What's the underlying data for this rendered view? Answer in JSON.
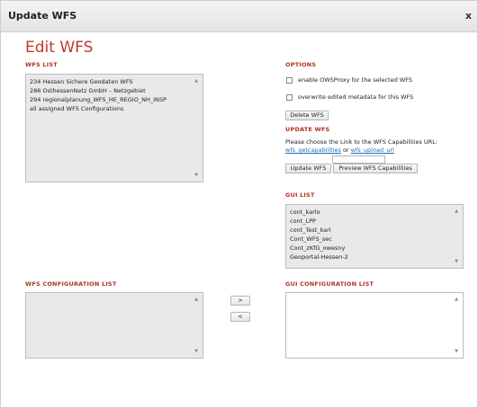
{
  "dialog": {
    "title": "Update WFS",
    "close_label": "x"
  },
  "heading": "Edit WFS",
  "wfs_list": {
    "label": "WFS LIST",
    "items": [
      "234 Hessen Sichere Geodaten WFS",
      "286 OsthessenNetz GmbH – Netzgebiet",
      "294 regionalplanung_WFS_HE_REGIO_NH_INSP",
      "all assigned WFS Configurations"
    ]
  },
  "options": {
    "label": "OPTIONS",
    "checkboxes": [
      "enable OWSProxy for the selected WFS",
      "overwrite edited metadata for this WFS"
    ],
    "delete_label": "Delete WFS"
  },
  "update_wfs": {
    "label": "UPDATE WFS",
    "instruction": "Please choose the Link to the WFS Capabilities URL:",
    "link_getcap": "wfs_getcapabilities",
    "link_or": "or",
    "link_upload": "wfs_upload_url",
    "update_label": "Update WFS",
    "preview_label": "Preview WFS Capabilities"
  },
  "gui_list": {
    "label": "GUI LIST",
    "items": [
      "cont_karlo",
      "cont_LPP",
      "cont_Test_karl",
      "Cont_WFS_sec",
      "Cont_zKfG_owesny",
      "Geoportal-Hessen-2"
    ]
  },
  "wfs_conf_list": {
    "label": "WFS CONFIGURATION LIST"
  },
  "gui_conf_list": {
    "label": "GUI CONFIGURATION LIST"
  },
  "move_buttons": {
    "add": ">",
    "remove": "<"
  },
  "icons": {
    "scroll_up": "chevron-up-icon",
    "scroll_down": "chevron-down-icon",
    "close": "close-icon"
  }
}
